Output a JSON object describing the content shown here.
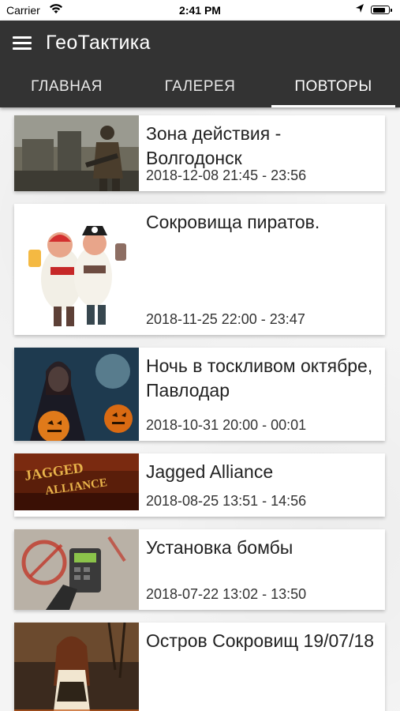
{
  "status_bar": {
    "carrier": "Carrier",
    "time": "2:41 PM",
    "battery_level": 0.85
  },
  "app_bar": {
    "title": "ГеоТактика",
    "menu_icon": "hamburger-menu-icon",
    "background_color": "#333333"
  },
  "tabs": [
    {
      "label": "ГЛАВНАЯ",
      "active": false
    },
    {
      "label": "ГАЛЕРЕЯ",
      "active": false
    },
    {
      "label": "ПОВТОРЫ",
      "active": true
    }
  ],
  "events": [
    {
      "title": "Зона действия - Волгодонск",
      "date": "2018-12-08 21:45 - 23:56",
      "thumbnail": "stalker-soldier-image"
    },
    {
      "title": "Сокровища пиратов.",
      "date": "2018-11-25 22:00 - 23:47",
      "thumbnail": "cartoon-pirates-image"
    },
    {
      "title": "Ночь в тоскливом октябре, Павлодар",
      "date": "2018-10-31 20:00 - 00:01",
      "thumbnail": "halloween-witch-image"
    },
    {
      "title": "Jagged Alliance",
      "date": "2018-08-25 13:51 - 14:56",
      "thumbnail": "jagged-alliance-logo-image"
    },
    {
      "title": "Установка бомбы",
      "date": "2018-07-22 13:02 - 13:50",
      "thumbnail": "bomb-device-image"
    },
    {
      "title": "Остров Сокровищ 19/07/18",
      "date": "",
      "thumbnail": "pirate-woman-image"
    }
  ]
}
